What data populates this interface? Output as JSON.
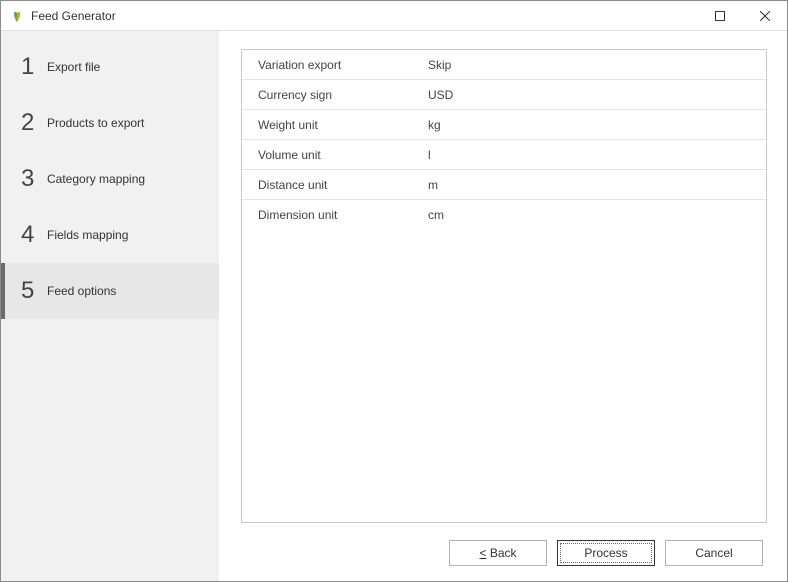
{
  "window": {
    "title": "Feed Generator"
  },
  "sidebar": {
    "steps": [
      {
        "num": "1",
        "label": "Export file"
      },
      {
        "num": "2",
        "label": "Products to export"
      },
      {
        "num": "3",
        "label": "Category mapping"
      },
      {
        "num": "4",
        "label": "Fields mapping"
      },
      {
        "num": "5",
        "label": "Feed options"
      }
    ],
    "activeIndex": 4
  },
  "options": [
    {
      "label": "Variation export",
      "value": "Skip"
    },
    {
      "label": "Currency sign",
      "value": "USD"
    },
    {
      "label": "Weight unit",
      "value": "kg"
    },
    {
      "label": "Volume unit",
      "value": "l"
    },
    {
      "label": "Distance unit",
      "value": "m"
    },
    {
      "label": "Dimension unit",
      "value": "cm"
    }
  ],
  "footer": {
    "back": "< Back",
    "process": "Process",
    "cancel": "Cancel"
  }
}
